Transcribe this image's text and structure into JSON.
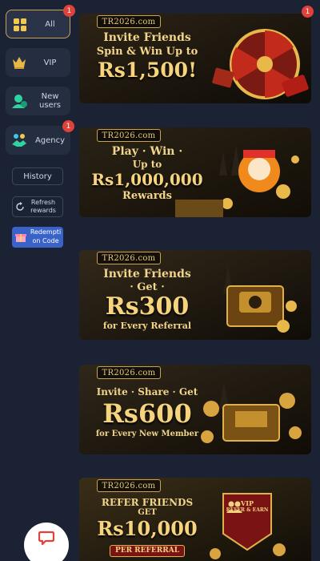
{
  "sidebar": {
    "items": [
      {
        "label": "All",
        "badge": "1",
        "icon": "grid-icon"
      },
      {
        "label": "VIP",
        "icon": "vip-crown-icon"
      },
      {
        "label": "New users",
        "icon": "new-user-icon"
      },
      {
        "label": "Agency",
        "badge": "1",
        "icon": "agency-handshake-icon"
      }
    ],
    "history_label": "History",
    "refresh_label": "Refresh rewards",
    "redeem_label": "Redempti on Code"
  },
  "banners": [
    {
      "brand": "TR2026.com",
      "line1": "Invite Friends",
      "line2": "Spin & Win Up to",
      "amount": "Rs1,500!",
      "badge": "1"
    },
    {
      "brand": "TR2026.com",
      "line1": "Play · Win ·",
      "line2": "Up to",
      "amount": "Rs1,000,000",
      "line3": "Rewards"
    },
    {
      "brand": "TR2026.com",
      "line1": "Invite Friends",
      "line2": "· Get ·",
      "amount": "Rs300",
      "line3": "for Every Referral"
    },
    {
      "brand": "TR2026.com",
      "line1": "Invite · Share · Get",
      "amount": "Rs600",
      "line3": "for Every New Member"
    },
    {
      "brand": "TR2026.com",
      "line1": "REFER FRIENDS",
      "line2": "GET",
      "amount": "Rs10,000",
      "line3": "PER REFERRAL",
      "shield_top": "VIP",
      "shield_bottom": "REFER & EARN"
    }
  ],
  "colors": {
    "background": "#1b2233",
    "gold": "#e8c878",
    "badge": "#e0413a",
    "accent_blue": "#3a63c9"
  }
}
